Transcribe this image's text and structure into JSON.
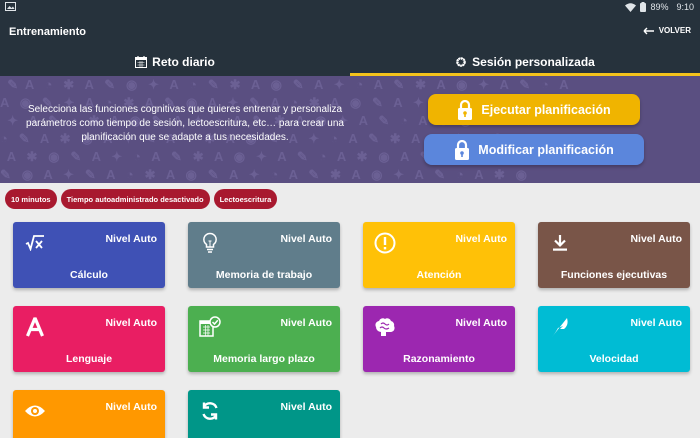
{
  "statusbar": {
    "battery": "89%",
    "time": "9:10"
  },
  "appbar": {
    "title": "Entrenamiento",
    "back_label": "VOLVER"
  },
  "tabs": [
    {
      "label": "Reto diario",
      "icon": "calendar-icon"
    },
    {
      "label": "Sesión personalizada",
      "icon": "gear-icon"
    }
  ],
  "banner": {
    "description": "Selecciona las funciones cognitivas que quieres entrenar y personaliza parámetros como tiempo de sesión, lectoescritura, etc… para crear una planificación que se adapte a tus necesidades.",
    "execute_label": "Ejecutar planificación",
    "modify_label": "Modificar planificación"
  },
  "chips": [
    "10 minutos",
    "Tiempo autoadministrado desactivado",
    "Lectoescritura"
  ],
  "cards": [
    {
      "name": "Cálculo",
      "level": "Nivel Auto",
      "color": "#3f51b5",
      "icon": "sqrt-icon"
    },
    {
      "name": "Memoria de trabajo",
      "level": "Nivel Auto",
      "color": "#607d8b",
      "icon": "lightbulb-icon"
    },
    {
      "name": "Atención",
      "level": "Nivel Auto",
      "color": "#ffc107",
      "icon": "exclamation-icon"
    },
    {
      "name": "Funciones ejecutivas",
      "level": "Nivel Auto",
      "color": "#795548",
      "icon": "download-icon"
    },
    {
      "name": "Lenguaje",
      "level": "Nivel Auto",
      "color": "#e91e63",
      "icon": "letter-a-icon"
    },
    {
      "name": "Memoria largo plazo",
      "level": "Nivel Auto",
      "color": "#4caf50",
      "icon": "calendar-check-icon"
    },
    {
      "name": "Razonamiento",
      "level": "Nivel Auto",
      "color": "#9c27b0",
      "icon": "brain-icon"
    },
    {
      "name": "Velocidad",
      "level": "Nivel Auto",
      "color": "#00bcd4",
      "icon": "feather-icon"
    },
    {
      "name": "",
      "level": "Nivel Auto",
      "color": "#ff9800",
      "icon": "eye-icon"
    },
    {
      "name": "",
      "level": "Nivel Auto",
      "color": "#009688",
      "icon": "sync-icon"
    }
  ]
}
